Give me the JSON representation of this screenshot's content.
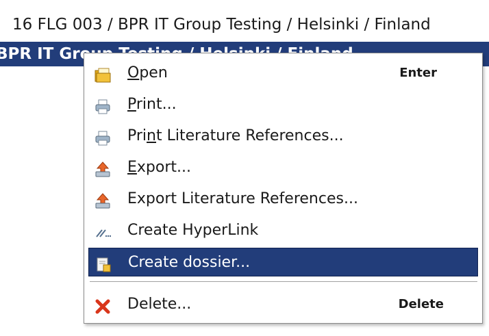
{
  "rows": {
    "row1": "16 FLG 003 / BPR IT Group Testing / Helsinki / Finland",
    "row2": "BPR IT Group Testing / Helsinki / Finland"
  },
  "menu": {
    "items": [
      {
        "mnemonic": "O",
        "rest": "pen",
        "shortcut": "Enter",
        "icon": "folder-icon"
      },
      {
        "mnemonic": "P",
        "rest": "rint...",
        "shortcut": "",
        "icon": "printer-icon"
      },
      {
        "pre": "Pri",
        "mnemonic": "n",
        "rest": "t Literature References...",
        "shortcut": "",
        "icon": "printer-icon"
      },
      {
        "mnemonic": "E",
        "rest": "xport...",
        "shortcut": "",
        "icon": "export-icon"
      },
      {
        "label": "Export Literature References...",
        "shortcut": "",
        "icon": "export-icon"
      },
      {
        "label": "Create HyperLink",
        "shortcut": "",
        "icon": "hyperlink-icon"
      },
      {
        "label": "Create dossier...",
        "shortcut": "",
        "icon": "dossier-icon",
        "highlighted": true
      },
      {
        "label": "Delete...",
        "shortcut": "Delete",
        "icon": "delete-x-icon"
      }
    ]
  },
  "colors": {
    "selection": "#223d7a",
    "delete_icon": "#d9361b"
  }
}
